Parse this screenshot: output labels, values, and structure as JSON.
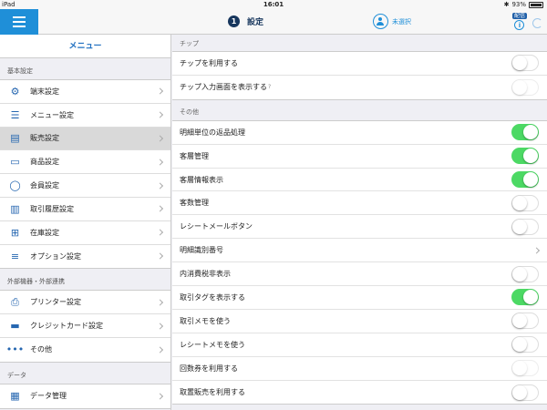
{
  "status_bar": {
    "device": "iPad",
    "time": "16:01",
    "battery": "93%"
  },
  "nav": {
    "step_number": "1",
    "title": "設定",
    "user_label": "未選択",
    "tag": "配信",
    "info_glyph": "i"
  },
  "sidebar": {
    "title": "メニュー",
    "sections": [
      {
        "label": "基本設定",
        "items": [
          {
            "label": "端末設定",
            "icon": "gear-icon",
            "glyph": "⚙"
          },
          {
            "label": "メニュー設定",
            "icon": "list-icon",
            "glyph": "☰"
          },
          {
            "label": "販売設定",
            "icon": "register-icon",
            "glyph": "▤",
            "active": true
          },
          {
            "label": "商品設定",
            "icon": "box-icon",
            "glyph": "▭"
          },
          {
            "label": "会員設定",
            "icon": "member-icon",
            "glyph": "◯"
          },
          {
            "label": "取引履歴設定",
            "icon": "book-icon",
            "glyph": "▥"
          },
          {
            "label": "在庫設定",
            "icon": "inventory-icon",
            "glyph": "⊞"
          },
          {
            "label": "オプション設定",
            "icon": "options-icon",
            "glyph": "≡"
          }
        ]
      },
      {
        "label": "外部機器・外部連携",
        "items": [
          {
            "label": "プリンター設定",
            "icon": "printer-icon",
            "glyph": "⎙"
          },
          {
            "label": "クレジットカード設定",
            "icon": "card-icon",
            "glyph": "▬"
          },
          {
            "label": "その他",
            "icon": "more-icon",
            "glyph": "•••"
          }
        ]
      },
      {
        "label": "データ",
        "items": [
          {
            "label": "データ管理",
            "icon": "data-icon",
            "glyph": "▦"
          }
        ]
      }
    ]
  },
  "main": {
    "groups": [
      {
        "label": "チップ",
        "rows": [
          {
            "label": "チップを利用する",
            "type": "toggle",
            "on": false,
            "disabled": false
          },
          {
            "label": "チップ入力画面を表示する",
            "type": "toggle",
            "on": false,
            "disabled": true,
            "help": "?"
          }
        ]
      },
      {
        "label": "その他",
        "rows": [
          {
            "label": "明細単位の返品処理",
            "type": "toggle",
            "on": true
          },
          {
            "label": "客層管理",
            "type": "toggle",
            "on": true
          },
          {
            "label": "客層情報表示",
            "type": "toggle",
            "on": true
          },
          {
            "label": "客数管理",
            "type": "toggle",
            "on": false
          },
          {
            "label": "レシートメールボタン",
            "type": "toggle",
            "on": false
          },
          {
            "label": "明細識別番号",
            "type": "link"
          },
          {
            "label": "内消費税非表示",
            "type": "toggle",
            "on": false
          },
          {
            "label": "取引タグを表示する",
            "type": "toggle",
            "on": true
          },
          {
            "label": "取引メモを使う",
            "type": "toggle",
            "on": false
          },
          {
            "label": "レシートメモを使う",
            "type": "toggle",
            "on": false
          },
          {
            "label": "回数券を利用する",
            "type": "toggle",
            "on": false,
            "disabled": true
          },
          {
            "label": "取置販売を利用する",
            "type": "toggle",
            "on": false
          }
        ]
      }
    ]
  }
}
